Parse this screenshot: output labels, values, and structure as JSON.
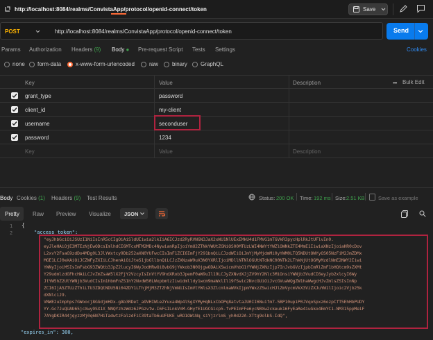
{
  "window": {
    "url": "http://localhost:8084/realms/ConvistaApp/protocol/openid-connect/token",
    "save_label": "Save"
  },
  "request": {
    "method": "POST",
    "url": "http://localhost:8084/realms/ConvistaApp/protocol/openid-connect/token",
    "send_label": "Send"
  },
  "request_tabs": [
    {
      "label": "Params"
    },
    {
      "label": "Authorization"
    },
    {
      "label": "Headers",
      "count": "(9)"
    },
    {
      "label": "Body",
      "count": "●"
    },
    {
      "label": "Pre-request Script"
    },
    {
      "label": "Tests"
    },
    {
      "label": "Settings"
    }
  ],
  "cookies_label": "Cookies",
  "body_types": [
    {
      "label": "none",
      "checked": false
    },
    {
      "label": "form-data",
      "checked": false
    },
    {
      "label": "x-www-form-urlencoded",
      "checked": true
    },
    {
      "label": "raw",
      "checked": false
    },
    {
      "label": "binary",
      "checked": false
    },
    {
      "label": "GraphQL",
      "checked": false
    }
  ],
  "params_table": {
    "headers": {
      "key": "Key",
      "value": "Value",
      "description": "Description",
      "bulk_edit": "Bulk Edit",
      "more": "•••"
    },
    "rows": [
      {
        "key": "grant_type",
        "value": "password",
        "checked": true
      },
      {
        "key": "client_id",
        "value": "my-client",
        "checked": true
      },
      {
        "key": "username",
        "value": "seconduser",
        "checked": true
      },
      {
        "key": "password",
        "value": "1234",
        "checked": true
      }
    ],
    "placeholder": {
      "key": "Key",
      "value": "Value",
      "description": "Description"
    }
  },
  "response": {
    "tabs": [
      {
        "label": "Body"
      },
      {
        "label": "Cookies",
        "count": "(1)"
      },
      {
        "label": "Headers",
        "count": "(9)"
      },
      {
        "label": "Test Results"
      }
    ],
    "status_label": "Status:",
    "status_value": "200 OK",
    "time_label": "Time:",
    "time_value": "192 ms",
    "size_label": "Size:",
    "size_value": "2.51 KB",
    "save_label": "Save as example",
    "view_tabs": [
      "Pretty",
      "Raw",
      "Preview",
      "Visualize"
    ],
    "format": "JSON",
    "line_numbers": [
      "1",
      "2"
    ],
    "open_brace": "{",
    "key_access_token": "\"access_token\":",
    "token_lines": [
      "\"eyJhbGciOiJSUzI1NiIsInR5cCIgOiAiSldUIiwia2lkIiA6ICJzd2RyRVNGN3JaX2xWU1NlUExEMkU4d1FMVG1mTGVkR3pycHplRkJtUFlvIn0.",
      "eyJleHAiOjE3MTEzNjEwODcsImlhdCI6MTcxMTM2MDc4NywianRpIjoiYmU2ZTNkYWUtZGNiOS00MTUzLWI4NWYtYWZlOWNkZTE4MmE1IiwiaXNzIjoiaHR0cDov",
      "L2xvY2FsaG9zdDo4MDg0L3JlYWxtcy9Db252aXN0YUFwcCIsImF1ZCI6ImFjY291bnQiLCJzdWIiOiJmYjMyMjdmMi0yYWM0LTQ5NDUtOWYyOS05NzFiM2JmZDMx",
      "MGE1LCJ0eXAiOiJCZWFyZXIiLCJhenAiOiJteS1jbGllbnQiLCJzZXNzaW9uX3N0YXRlIjoiMDllNTNlOGUtNTdkNC00NTk2LThkNjUtOGMyMzdlNmE2NWY2Iiwi",
      "YWNyIjoiMSIsImFsbG93ZWQtb3JpZ2lucyI6WyJodHRwOi8vbG9jYWxob3N0OjgwODAiXSwicmVhbG1fYWNjZXNzIjp7InJvbGVzIjpbImRlZmF1bHQtcm9sZXMt",
      "Y29udmlzdGFhcHAiLCJvZmZsaW5lX2FjY2VzcyIsInVtYV9hdXRob3JpemF0aW9uIl19LCJyZXNvdXJjZV9hY2Nlc3MiOnsiYWNjb3VudCI6eyJyb2xlcyI6Wy",
      "JtYW5hZ2UtYWNjb3VudCIsIm1hbmFnZS1hY2NvdW50LWxpbmtzIiwidmlldy1wcm9maWxlIl19fSwic2NvcGUiOiJvcGVuaWQgZW1haWwgcHJvZmlsZSIsInNp",
      "ZCI6IjA5ZTUzZThlLTU3ZDQtNDU5Ni04ZDY1LThjMjM3ZTZhNjVmNiIsImVtYWlsX3ZlcmlmaWVkIjpmYWxzZSwicHJlZmVycmVkX3VzZXJuYW1lIjoic2Vjb25k",
      "dXNlciJ9.",
      "VNWE2uImphps7GWoocj8GGdjmHDx-gAb3RDet_a9VHIWie2Yuxa4Wp4lSgXYMyHqNLxCbOPq8atvtaJU0II6Nuifm7-5BP10upiP0JVqoSpxz6ozpCfT5EhHbPUDY",
      "YY-Gc7JuQUAU65jcXwy9SX1X_NNQYzhzWdz6JPGzvtw-I6FsILnkVnM-GHyfE1UGCGicp5-fvPEImFFe6ycN0Xw2ckeuk16FyEaRe4iuGko4EmYC1-NM315ppMeiF",
      "7AYgDKIR44jqyzzMj0q6N7HiTadwtzFalzdFiC39taTb6uUFUKE_wRO1OWiNq_siYjzrlmS_yh0d22A-XTtg9olbS-IdQ\","
    ],
    "key_expires": "\"expires_in\": 300,"
  },
  "colors": {
    "accent": "#ff6c37",
    "send": "#097bed",
    "method": "#ffb400",
    "status_ok": "#3fa34d",
    "highlight_box": "#b0233f"
  }
}
